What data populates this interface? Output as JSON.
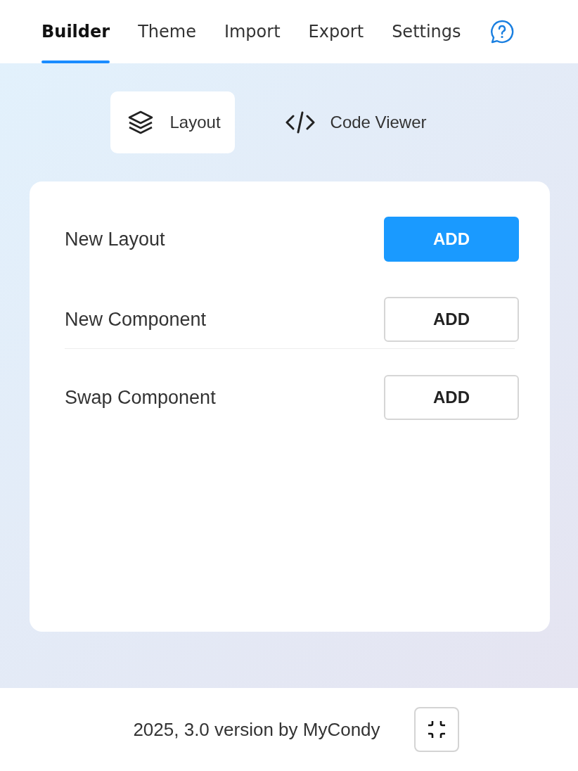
{
  "tabs": [
    {
      "label": "Builder",
      "selected": true
    },
    {
      "label": "Theme",
      "selected": false
    },
    {
      "label": "Import",
      "selected": false
    },
    {
      "label": "Export",
      "selected": false
    },
    {
      "label": "Settings",
      "selected": false
    }
  ],
  "views": [
    {
      "label": "Layout",
      "kind": "layers",
      "selected": true
    },
    {
      "label": "Code Viewer",
      "kind": "code",
      "selected": false
    }
  ],
  "sections": [
    {
      "rows": [
        {
          "label": "New Layout",
          "button": "ADD",
          "primary": true
        },
        {
          "label": "New Component",
          "button": "ADD",
          "primary": false
        }
      ]
    },
    {
      "rows": [
        {
          "label": "Swap Component",
          "button": "ADD",
          "primary": false
        }
      ]
    }
  ],
  "footer": {
    "text": "2025, 3.0 version by MyCondy"
  }
}
